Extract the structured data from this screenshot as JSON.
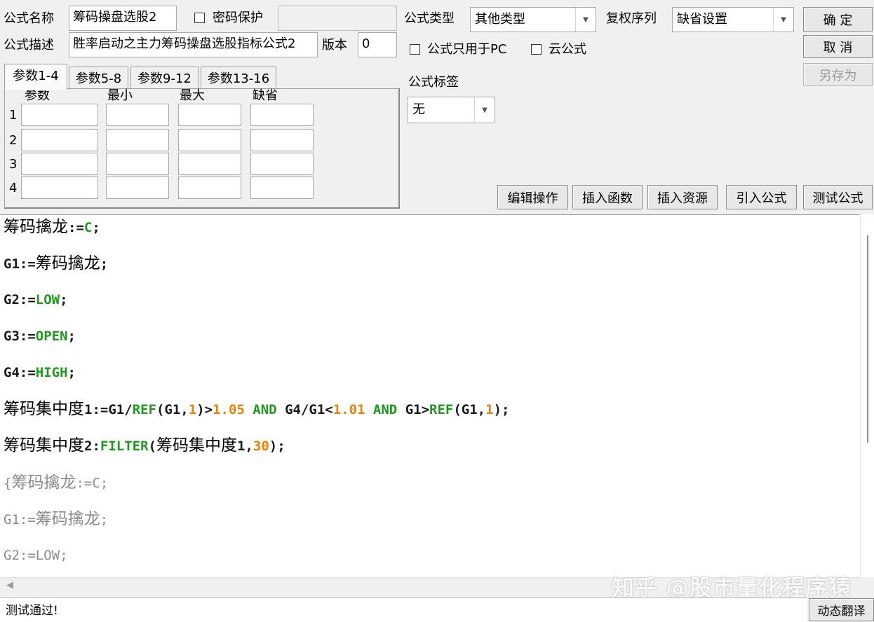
{
  "header": {
    "name_label": "公式名称",
    "name_value": "筹码操盘选股2",
    "password_label": "密码保护",
    "desc_label": "公式描述",
    "desc_value": "胜率启动之主力筹码操盘选股指标公式2",
    "version_label": "版本",
    "version_value": "0",
    "type_label": "公式类型",
    "type_value": "其他类型",
    "rights_label": "复权序列",
    "rights_value": "缺省设置",
    "pc_only_label": "公式只用于PC",
    "cloud_label": "云公式",
    "tag_label": "公式标签",
    "tag_value": "无"
  },
  "buttons": {
    "ok": "确 定",
    "cancel": "取 消",
    "save_as": "另存为",
    "edit_ops": "编辑操作",
    "insert_func": "插入函数",
    "insert_res": "插入资源",
    "import_formula": "引入公式",
    "test_formula": "测试公式",
    "dynamic_translate": "动态翻译"
  },
  "tabs": [
    "参数1-4",
    "参数5-8",
    "参数9-12",
    "参数13-16"
  ],
  "params": {
    "headers": [
      "参数",
      "最小",
      "最大",
      "缺省"
    ],
    "rows": [
      "1",
      "2",
      "3",
      "4"
    ]
  },
  "code_lines": [
    [
      {
        "t": "筹码擒龙",
        "c": "cn"
      },
      {
        "t": ":=",
        "c": "k"
      },
      {
        "t": "C",
        "c": "g"
      },
      {
        "t": ";",
        "c": "k"
      }
    ],
    [
      {
        "t": "G1:=",
        "c": "k"
      },
      {
        "t": "筹码擒龙",
        "c": "cn"
      },
      {
        "t": ";",
        "c": "k"
      }
    ],
    [
      {
        "t": "G2:=",
        "c": "k"
      },
      {
        "t": "LOW",
        "c": "g"
      },
      {
        "t": ";",
        "c": "k"
      }
    ],
    [
      {
        "t": "G3:=",
        "c": "k"
      },
      {
        "t": "OPEN",
        "c": "g"
      },
      {
        "t": ";",
        "c": "k"
      }
    ],
    [
      {
        "t": "G4:=",
        "c": "k"
      },
      {
        "t": "HIGH",
        "c": "g"
      },
      {
        "t": ";",
        "c": "k"
      }
    ],
    [
      {
        "t": "筹码集中度",
        "c": "cn"
      },
      {
        "t": "1:=G1/",
        "c": "k"
      },
      {
        "t": "REF",
        "c": "g"
      },
      {
        "t": "(G1,",
        "c": "k"
      },
      {
        "t": "1",
        "c": "o"
      },
      {
        "t": ")>",
        "c": "k"
      },
      {
        "t": "1.05",
        "c": "o"
      },
      {
        "t": " ",
        "c": "k"
      },
      {
        "t": "AND",
        "c": "g"
      },
      {
        "t": " G4/G1<",
        "c": "k"
      },
      {
        "t": "1.01",
        "c": "o"
      },
      {
        "t": " ",
        "c": "k"
      },
      {
        "t": "AND",
        "c": "g"
      },
      {
        "t": " G1>",
        "c": "k"
      },
      {
        "t": "REF",
        "c": "g"
      },
      {
        "t": "(G1,",
        "c": "k"
      },
      {
        "t": "1",
        "c": "o"
      },
      {
        "t": ");",
        "c": "k"
      }
    ],
    [
      {
        "t": "筹码集中度",
        "c": "cn"
      },
      {
        "t": "2:",
        "c": "k"
      },
      {
        "t": "FILTER",
        "c": "g"
      },
      {
        "t": "(",
        "c": "k"
      },
      {
        "t": "筹码集中度",
        "c": "cn"
      },
      {
        "t": "1,",
        "c": "k"
      },
      {
        "t": "30",
        "c": "o"
      },
      {
        "t": ");",
        "c": "k"
      }
    ],
    [
      {
        "t": "{",
        "c": "k"
      },
      {
        "t": "筹码擒龙",
        "c": "cn"
      },
      {
        "t": ":=C;",
        "c": "k"
      }
    ],
    [
      {
        "t": "G1:=",
        "c": "k"
      },
      {
        "t": "筹码擒龙",
        "c": "cn"
      },
      {
        "t": ";",
        "c": "k"
      }
    ],
    [
      {
        "t": "G2:=LOW;",
        "c": "k"
      }
    ]
  ],
  "comment_from_line": 7,
  "status_text": "测试通过!",
  "watermark": "知乎 @股市量化程序猿",
  "colors": {
    "keyword_green": "#1f9a1f",
    "number_orange": "#f08000",
    "comment_gray": "#8c8c8c"
  }
}
